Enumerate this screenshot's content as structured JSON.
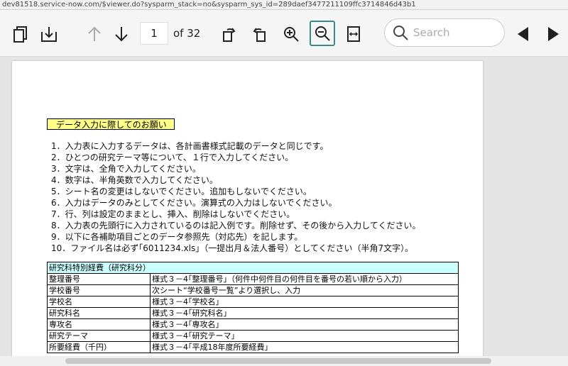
{
  "url": "dev81518.service-now.com/$viewer.do?sysparm_stack=no&sysparm_sys_id=289daef3477211109ffc3714846d43b1",
  "toolbar": {
    "page_current": "1",
    "page_total": "of 32",
    "search_placeholder": "Search"
  },
  "document": {
    "notice_title": "データ入力に際してのお願い",
    "items": [
      "1．入力表に入力するデータは、各計画書様式記載のデータと同じです。",
      "2．ひとつの研究テーマ等について、１行で入力してください。",
      "3．文字は、全角で入力してください。",
      "4．数字は、半角英数で入力してください。",
      "5．シート名の変更はしないでください。追加もしないでください。",
      "6．入力はデータのみとしてください。演算式の入力はしないでください。",
      "7．行、列は設定のままとし、挿入、削除はしないでください。",
      "8．入力表の先頭行に入力されているのは記入例です。削除せず、その後から入力してください。",
      "9．以下に各補助項目ごとのデータ参照先（対応先）を記します。",
      "10．ファイル名は必ず｢6011234.xls｣（一提出月＆法人番号）としてください（半角7文字）。"
    ],
    "table_header": "研究科特別経費（研究科分）",
    "table_rows": [
      {
        "field": "整理番号",
        "ref": "様式３－4｢整理番号｣（何件中何件目の何件目を番号の若い順から入力）"
      },
      {
        "field": "学校番号",
        "ref": "次シート“学校番号一覧”より選択し、入力"
      },
      {
        "field": "学校名",
        "ref": "様式３－4｢学校名｣"
      },
      {
        "field": "研究科名",
        "ref": "様式３－4｢研究科名｣"
      },
      {
        "field": "専攻名",
        "ref": "様式３－4｢専攻名｣"
      },
      {
        "field": "研究テーマ",
        "ref": "様式３－4｢研究テーマ｣"
      },
      {
        "field": "所要経費（千円）",
        "ref": "様式３－4｢平成18年度所要経費｣"
      }
    ]
  }
}
